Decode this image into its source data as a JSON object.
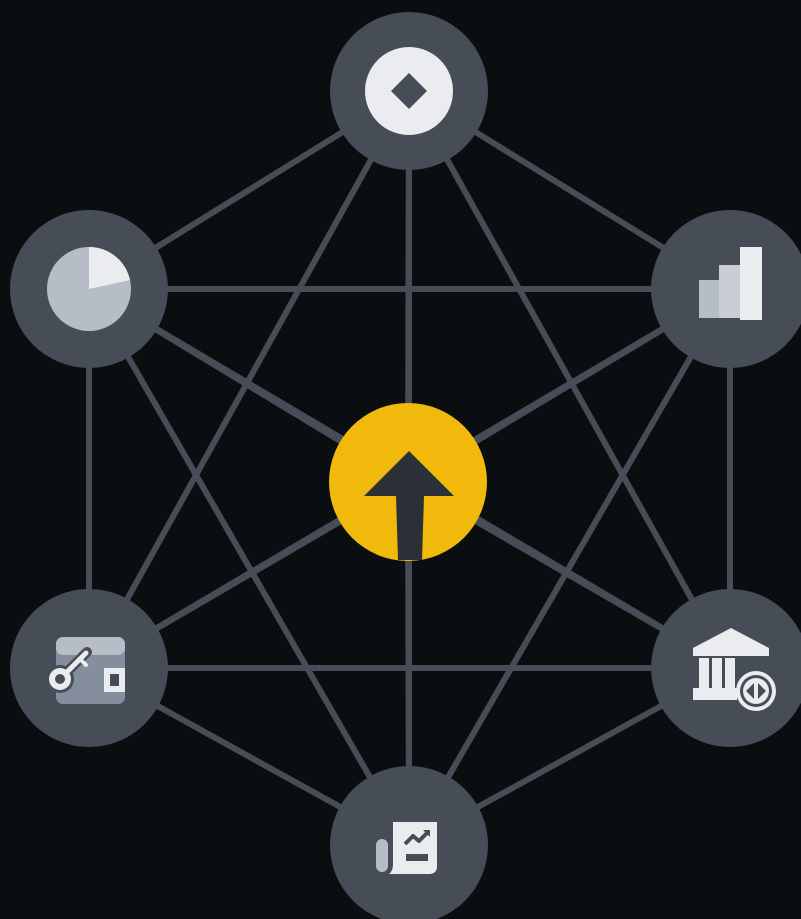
{
  "colors": {
    "background": "#0b0e11",
    "edge": "#474d57",
    "node_fill": "#474d57",
    "hub_fill": "#f0b90b",
    "hub_arrow": "#2b2f36",
    "icon_light": "#eaecef",
    "icon_mid": "#b7bdc6",
    "icon_dark": "#848e9c"
  },
  "hub": {
    "icon": "arrow-up-icon"
  },
  "nodes": [
    {
      "id": "top",
      "icon": "coin-diamond-icon"
    },
    {
      "id": "upper-right",
      "icon": "bar-chart-icon"
    },
    {
      "id": "lower-right",
      "icon": "bank-exchange-icon"
    },
    {
      "id": "bottom",
      "icon": "report-chart-icon"
    },
    {
      "id": "lower-left",
      "icon": "wallet-key-icon"
    },
    {
      "id": "upper-left",
      "icon": "pie-chart-icon"
    }
  ],
  "edges": {
    "complete_graph": true,
    "spokes_to_hub": true
  }
}
